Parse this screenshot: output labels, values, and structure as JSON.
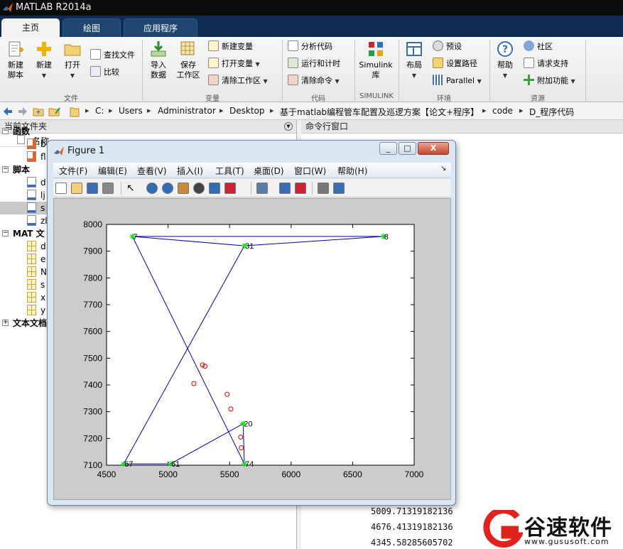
{
  "app": {
    "title": "MATLAB R2014a"
  },
  "ribbon": {
    "tabs": [
      {
        "label": "主页",
        "active": true
      },
      {
        "label": "绘图",
        "active": false
      },
      {
        "label": "应用程序",
        "active": false
      }
    ],
    "groups": {
      "file": "文件",
      "variable": "变量",
      "code": "代码",
      "simulink": "SIMULINK",
      "environment": "环境",
      "resources": "资源"
    },
    "buttons": {
      "new_script": [
        "新建",
        "脚本"
      ],
      "new": "新建",
      "open": "打开",
      "find_files": "查找文件",
      "compare": "比较",
      "import_data": [
        "导入",
        "数据"
      ],
      "save_workspace": [
        "保存",
        "工作区"
      ],
      "new_variable": "新建变量",
      "open_variable": "打开变量",
      "clear_workspace": "清除工作区",
      "analyze_code": "分析代码",
      "run_and_time": "运行和计时",
      "clear_commands": "清除命令",
      "simulink_library": [
        "Simulink",
        "库"
      ],
      "layout": "布局",
      "preferences": "预设",
      "set_path": "设置路径",
      "parallel": "Parallel",
      "help": "帮助",
      "community": "社区",
      "request_support": "请求支持",
      "add_ons": "附加功能"
    }
  },
  "address": {
    "crumbs": [
      "C:",
      "Users",
      "Administrator",
      "Desktop",
      "基于matlab编程管车配置及巡逻方案【论文+程序】",
      "code",
      "D_程序代码"
    ]
  },
  "current_folder": {
    "title": "当前文件夹",
    "name_column": "名称",
    "groups": [
      {
        "label": "函数",
        "items": [
          "b",
          "fl"
        ]
      },
      {
        "label": "脚本",
        "items": [
          "d",
          "lj",
          "s",
          "zl"
        ]
      },
      {
        "label": "MAT 文",
        "items": [
          "d",
          "e",
          "N",
          "s",
          "x",
          "y"
        ]
      },
      {
        "label": "文本文档",
        "items": []
      }
    ]
  },
  "command_window": {
    "title": "命令行窗口",
    "lines": [
      "5009.71319182136",
      "4676.41319182136",
      "4345.58285605702"
    ]
  },
  "figure": {
    "title": "Figure 1",
    "menu": [
      "文件(F)",
      "编辑(E)",
      "查看(V)",
      "插入(I)",
      "工具(T)",
      "桌面(D)",
      "窗口(W)",
      "帮助(H)"
    ],
    "window_buttons": [
      "_",
      "□",
      "X"
    ],
    "toolbar_icons": [
      "new-figure-icon",
      "open-file-icon",
      "save-icon",
      "print-icon",
      "pointer-icon",
      "zoom-in-icon",
      "zoom-out-icon",
      "pan-icon",
      "rotate-icon",
      "data-cursor-icon",
      "brush-icon",
      "link-plot-icon",
      "colorbar-icon",
      "legend-icon",
      "hide-plot-tools-icon",
      "show-plot-tools-icon"
    ]
  },
  "chart_data": {
    "type": "line",
    "xlim": [
      4500,
      7000
    ],
    "ylim": [
      7100,
      8000
    ],
    "xticks": [
      4500,
      5000,
      5500,
      6000,
      6500,
      7000
    ],
    "yticks": [
      7100,
      7200,
      7300,
      7400,
      7500,
      7600,
      7700,
      7800,
      7900,
      8000
    ],
    "grid": false,
    "series": [
      {
        "style": "line",
        "color": "#0000a8",
        "points": [
          [
            4710,
            7955
          ],
          [
            5620,
            7920
          ],
          [
            6750,
            7955
          ],
          [
            4710,
            7955
          ],
          [
            5620,
            7105
          ],
          [
            5610,
            7255
          ],
          [
            5020,
            7105
          ],
          [
            4640,
            7105
          ],
          [
            5620,
            7920
          ]
        ]
      },
      {
        "style": "star",
        "color": "#00ee00",
        "points": [
          [
            4710,
            7955
          ],
          [
            5620,
            7920
          ],
          [
            6750,
            7955
          ],
          [
            5610,
            7255
          ],
          [
            5020,
            7105
          ],
          [
            4640,
            7105
          ],
          [
            5620,
            7105
          ]
        ]
      },
      {
        "style": "circle",
        "color": "#d40000",
        "points": [
          [
            5280,
            7475
          ],
          [
            5300,
            7470
          ],
          [
            5210,
            7405
          ],
          [
            5480,
            7365
          ],
          [
            5510,
            7310
          ],
          [
            5590,
            7205
          ],
          [
            5595,
            7165
          ]
        ]
      }
    ],
    "labels": [
      {
        "x": 4710,
        "y": 7955,
        "text": "7"
      },
      {
        "x": 5620,
        "y": 7920,
        "text": "31"
      },
      {
        "x": 6750,
        "y": 7955,
        "text": "8"
      },
      {
        "x": 5610,
        "y": 7255,
        "text": "20"
      },
      {
        "x": 5020,
        "y": 7105,
        "text": "61"
      },
      {
        "x": 4640,
        "y": 7105,
        "text": "67"
      },
      {
        "x": 5620,
        "y": 7105,
        "text": "74"
      }
    ]
  },
  "watermark": {
    "brand": "谷速软件",
    "url": "www.gususoft.com"
  }
}
